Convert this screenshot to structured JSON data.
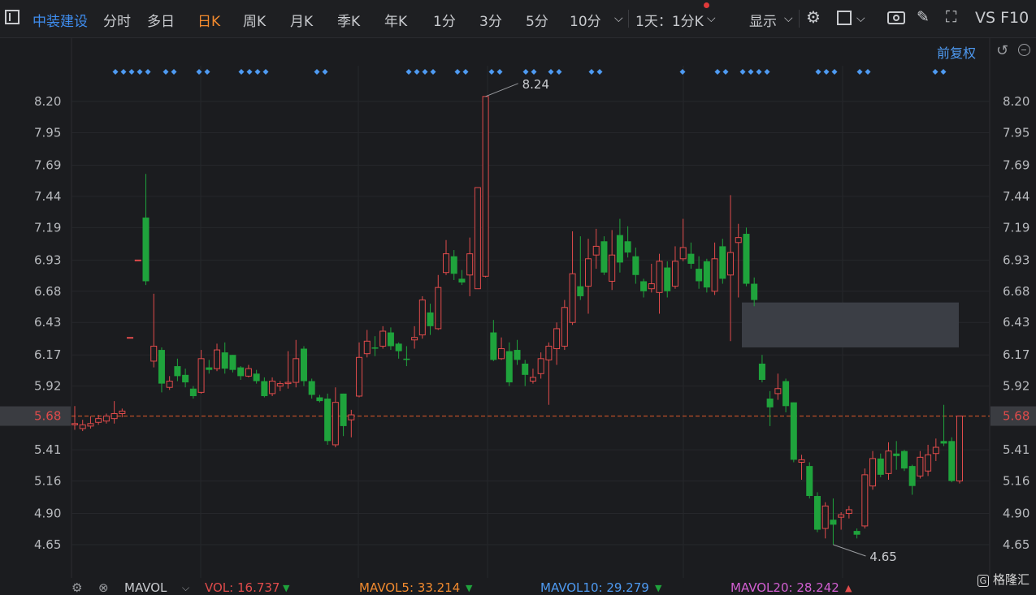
{
  "toolbar": {
    "stock_name": "中装建设",
    "periods": [
      "分时",
      "多日",
      "日K",
      "周K",
      "月K",
      "季K",
      "年K",
      "1分",
      "3分",
      "5分",
      "10分"
    ],
    "active_period": "日K",
    "range_select": "1天：1分K",
    "display_label": "显示",
    "right_text": "VS F10"
  },
  "sub_toolbar": {
    "adjust_label": "前复权"
  },
  "chart_data": {
    "type": "candlestick",
    "y_ticks": [
      8.2,
      7.95,
      7.69,
      7.44,
      7.19,
      6.93,
      6.68,
      6.43,
      6.17,
      5.92,
      5.68,
      5.41,
      5.16,
      4.9,
      4.65
    ],
    "y_tick_labels": [
      "8.20",
      "7.95",
      "7.69",
      "7.44",
      "7.19",
      "6.93",
      "6.68",
      "6.43",
      "6.17",
      "5.92",
      "5.68",
      "5.41",
      "5.16",
      "4.90",
      "4.65"
    ],
    "current_price": "5.68",
    "high_label": "8.24",
    "low_label": "4.65",
    "gap_zone": [
      6.23,
      6.59
    ],
    "up_color": "#e04b4b",
    "down_color": "#1fa33c",
    "candles": [
      {
        "o": 5.61,
        "c": 5.62,
        "h": 5.76,
        "l": 5.57
      },
      {
        "o": 5.58,
        "c": 5.61,
        "h": 5.65,
        "l": 5.56
      },
      {
        "o": 5.6,
        "c": 5.62,
        "h": 5.68,
        "l": 5.58
      },
      {
        "o": 5.63,
        "c": 5.66,
        "h": 5.69,
        "l": 5.61
      },
      {
        "o": 5.64,
        "c": 5.68,
        "h": 5.7,
        "l": 5.62
      },
      {
        "o": 5.66,
        "c": 5.7,
        "h": 5.8,
        "l": 5.62
      },
      {
        "o": 5.7,
        "c": 5.72,
        "h": 5.74,
        "l": 5.67
      },
      {
        "o": 6.31,
        "c": 6.31,
        "h": 6.31,
        "l": 6.31
      },
      {
        "o": 6.93,
        "c": 6.93,
        "h": 6.93,
        "l": 6.93
      },
      {
        "o": 7.27,
        "c": 6.76,
        "h": 7.62,
        "l": 6.73
      },
      {
        "o": 6.12,
        "c": 6.24,
        "h": 6.66,
        "l": 6.07
      },
      {
        "o": 6.21,
        "c": 5.94,
        "h": 6.23,
        "l": 5.87
      },
      {
        "o": 5.91,
        "c": 5.96,
        "h": 6.0,
        "l": 5.89
      },
      {
        "o": 6.08,
        "c": 6.0,
        "h": 6.14,
        "l": 5.96
      },
      {
        "o": 6.01,
        "c": 5.95,
        "h": 6.06,
        "l": 5.91
      },
      {
        "o": 5.9,
        "c": 5.84,
        "h": 5.92,
        "l": 5.82
      },
      {
        "o": 5.87,
        "c": 6.14,
        "h": 6.21,
        "l": 5.86
      },
      {
        "o": 6.07,
        "c": 6.05,
        "h": 6.13,
        "l": 6.02
      },
      {
        "o": 6.06,
        "c": 6.21,
        "h": 6.26,
        "l": 6.04
      },
      {
        "o": 6.19,
        "c": 6.06,
        "h": 6.27,
        "l": 6.02
      },
      {
        "o": 6.17,
        "c": 6.05,
        "h": 6.17,
        "l": 6.03
      },
      {
        "o": 6.07,
        "c": 6.0,
        "h": 6.08,
        "l": 5.97
      },
      {
        "o": 6.0,
        "c": 6.06,
        "h": 6.09,
        "l": 5.99
      },
      {
        "o": 6.02,
        "c": 5.96,
        "h": 6.05,
        "l": 5.94
      },
      {
        "o": 5.96,
        "c": 5.84,
        "h": 5.99,
        "l": 5.83
      },
      {
        "o": 5.86,
        "c": 5.96,
        "h": 5.99,
        "l": 5.84
      },
      {
        "o": 5.92,
        "c": 5.94,
        "h": 5.96,
        "l": 5.88
      },
      {
        "o": 5.94,
        "c": 5.95,
        "h": 6.2,
        "l": 5.9
      },
      {
        "o": 5.95,
        "c": 6.14,
        "h": 6.29,
        "l": 5.91
      },
      {
        "o": 6.22,
        "c": 5.96,
        "h": 6.24,
        "l": 5.92
      },
      {
        "o": 5.96,
        "c": 5.85,
        "h": 5.98,
        "l": 5.82
      },
      {
        "o": 5.83,
        "c": 5.8,
        "h": 5.85,
        "l": 5.79
      },
      {
        "o": 5.82,
        "c": 5.48,
        "h": 5.86,
        "l": 5.45
      },
      {
        "o": 5.45,
        "c": 5.79,
        "h": 5.91,
        "l": 5.43
      },
      {
        "o": 5.86,
        "c": 5.6,
        "h": 5.86,
        "l": 5.52
      },
      {
        "o": 5.65,
        "c": 5.69,
        "h": 5.73,
        "l": 5.51
      },
      {
        "o": 5.84,
        "c": 6.15,
        "h": 6.27,
        "l": 5.83
      },
      {
        "o": 6.18,
        "c": 6.28,
        "h": 6.37,
        "l": 6.15
      },
      {
        "o": 6.23,
        "c": 6.22,
        "h": 6.32,
        "l": 6.16
      },
      {
        "o": 6.24,
        "c": 6.36,
        "h": 6.4,
        "l": 6.22
      },
      {
        "o": 6.35,
        "c": 6.24,
        "h": 6.39,
        "l": 6.21
      },
      {
        "o": 6.26,
        "c": 6.2,
        "h": 6.27,
        "l": 6.14
      },
      {
        "o": 6.14,
        "c": 6.13,
        "h": 6.24,
        "l": 6.08
      },
      {
        "o": 6.29,
        "c": 6.31,
        "h": 6.4,
        "l": 6.22
      },
      {
        "o": 6.33,
        "c": 6.61,
        "h": 6.64,
        "l": 6.3
      },
      {
        "o": 6.51,
        "c": 6.4,
        "h": 6.58,
        "l": 6.33
      },
      {
        "o": 6.38,
        "c": 6.71,
        "h": 6.81,
        "l": 6.37
      },
      {
        "o": 6.83,
        "c": 6.98,
        "h": 7.09,
        "l": 6.81
      },
      {
        "o": 6.96,
        "c": 6.82,
        "h": 7.01,
        "l": 6.77
      },
      {
        "o": 6.78,
        "c": 6.75,
        "h": 6.85,
        "l": 6.73
      },
      {
        "o": 6.81,
        "c": 6.98,
        "h": 7.11,
        "l": 6.64
      },
      {
        "o": 6.7,
        "c": 7.51,
        "h": 7.51,
        "l": 6.7
      },
      {
        "o": 6.8,
        "c": 8.24,
        "h": 8.24,
        "l": 6.79
      },
      {
        "o": 6.35,
        "c": 6.13,
        "h": 6.45,
        "l": 6.12
      },
      {
        "o": 6.14,
        "c": 6.22,
        "h": 6.31,
        "l": 6.13
      },
      {
        "o": 6.2,
        "c": 5.95,
        "h": 6.27,
        "l": 5.92
      },
      {
        "o": 6.21,
        "c": 6.13,
        "h": 6.29,
        "l": 6.09
      },
      {
        "o": 6.1,
        "c": 6.01,
        "h": 6.13,
        "l": 5.92
      },
      {
        "o": 5.96,
        "c": 5.99,
        "h": 6.06,
        "l": 5.94
      },
      {
        "o": 6.02,
        "c": 6.14,
        "h": 6.19,
        "l": 5.98
      },
      {
        "o": 6.13,
        "c": 6.24,
        "h": 6.27,
        "l": 5.77
      },
      {
        "o": 6.22,
        "c": 6.38,
        "h": 6.43,
        "l": 6.09
      },
      {
        "o": 6.24,
        "c": 6.55,
        "h": 6.61,
        "l": 6.21
      },
      {
        "o": 6.43,
        "c": 6.82,
        "h": 7.16,
        "l": 6.41
      },
      {
        "o": 6.72,
        "c": 6.64,
        "h": 7.12,
        "l": 6.61
      },
      {
        "o": 6.72,
        "c": 6.94,
        "h": 7.1,
        "l": 6.5
      },
      {
        "o": 6.97,
        "c": 7.04,
        "h": 7.18,
        "l": 6.86
      },
      {
        "o": 7.08,
        "c": 6.83,
        "h": 7.12,
        "l": 6.81
      },
      {
        "o": 6.76,
        "c": 6.97,
        "h": 7.17,
        "l": 6.69
      },
      {
        "o": 7.13,
        "c": 6.91,
        "h": 7.26,
        "l": 6.83
      },
      {
        "o": 7.08,
        "c": 6.99,
        "h": 7.2,
        "l": 6.95
      },
      {
        "o": 6.96,
        "c": 6.81,
        "h": 7.03,
        "l": 6.74
      },
      {
        "o": 6.76,
        "c": 6.68,
        "h": 6.78,
        "l": 6.63
      },
      {
        "o": 6.7,
        "c": 6.74,
        "h": 6.9,
        "l": 6.67
      },
      {
        "o": 6.67,
        "c": 6.92,
        "h": 6.98,
        "l": 6.5
      },
      {
        "o": 6.87,
        "c": 6.68,
        "h": 6.92,
        "l": 6.63
      },
      {
        "o": 6.72,
        "c": 6.92,
        "h": 7.04,
        "l": 6.7
      },
      {
        "o": 6.94,
        "c": 7.03,
        "h": 7.26,
        "l": 6.92
      },
      {
        "o": 6.98,
        "c": 6.9,
        "h": 7.07,
        "l": 6.86
      },
      {
        "o": 6.86,
        "c": 6.76,
        "h": 6.96,
        "l": 6.7
      },
      {
        "o": 6.92,
        "c": 6.71,
        "h": 6.94,
        "l": 6.67
      },
      {
        "o": 6.68,
        "c": 6.94,
        "h": 7.07,
        "l": 6.65
      },
      {
        "o": 7.04,
        "c": 6.78,
        "h": 7.1,
        "l": 6.74
      },
      {
        "o": 6.81,
        "c": 6.99,
        "h": 7.45,
        "l": 6.28
      },
      {
        "o": 7.07,
        "c": 7.11,
        "h": 7.22,
        "l": 6.63
      },
      {
        "o": 7.14,
        "c": 6.74,
        "h": 7.19,
        "l": 6.72
      },
      {
        "o": 6.74,
        "c": 6.61,
        "h": 6.79,
        "l": 6.56
      },
      {
        "o": 6.1,
        "c": 5.97,
        "h": 6.17,
        "l": 5.95
      },
      {
        "o": 5.82,
        "c": 5.75,
        "h": 5.88,
        "l": 5.6
      },
      {
        "o": 5.86,
        "c": 5.9,
        "h": 6.02,
        "l": 5.81
      },
      {
        "o": 5.96,
        "c": 5.76,
        "h": 5.98,
        "l": 5.71
      },
      {
        "o": 5.79,
        "c": 5.33,
        "h": 5.79,
        "l": 5.31
      },
      {
        "o": 5.31,
        "c": 5.33,
        "h": 5.37,
        "l": 5.17
      },
      {
        "o": 5.28,
        "c": 5.04,
        "h": 5.31,
        "l": 5.02
      },
      {
        "o": 5.04,
        "c": 4.77,
        "h": 5.07,
        "l": 4.75
      },
      {
        "o": 4.78,
        "c": 4.96,
        "h": 4.99,
        "l": 4.7
      },
      {
        "o": 4.85,
        "c": 4.81,
        "h": 5.02,
        "l": 4.65
      },
      {
        "o": 4.87,
        "c": 4.89,
        "h": 4.91,
        "l": 4.77
      },
      {
        "o": 4.9,
        "c": 4.93,
        "h": 4.96,
        "l": 4.86
      },
      {
        "o": 4.76,
        "c": 4.73,
        "h": 4.78,
        "l": 4.7
      },
      {
        "o": 4.8,
        "c": 5.21,
        "h": 5.26,
        "l": 4.78
      },
      {
        "o": 5.12,
        "c": 5.34,
        "h": 5.4,
        "l": 5.09
      },
      {
        "o": 5.34,
        "c": 5.21,
        "h": 5.38,
        "l": 5.19
      },
      {
        "o": 5.22,
        "c": 5.4,
        "h": 5.47,
        "l": 5.17
      },
      {
        "o": 5.38,
        "c": 5.36,
        "h": 5.48,
        "l": 5.25
      },
      {
        "o": 5.4,
        "c": 5.26,
        "h": 5.41,
        "l": 5.24
      },
      {
        "o": 5.28,
        "c": 5.12,
        "h": 5.29,
        "l": 5.05
      },
      {
        "o": 5.2,
        "c": 5.35,
        "h": 5.4,
        "l": 5.18
      },
      {
        "o": 5.24,
        "c": 5.37,
        "h": 5.45,
        "l": 5.2
      },
      {
        "o": 5.38,
        "c": 5.43,
        "h": 5.5,
        "l": 5.32
      },
      {
        "o": 5.48,
        "c": 5.46,
        "h": 5.77,
        "l": 5.44
      },
      {
        "o": 5.48,
        "c": 5.16,
        "h": 5.51,
        "l": 5.15
      },
      {
        "o": 5.16,
        "c": 5.68,
        "h": 5.68,
        "l": 5.14
      }
    ]
  },
  "bottom_bar": {
    "ma_label": "MAVOL",
    "vol": "VOL: 16.737",
    "mavol5": "MAVOL5: 33.214",
    "mavol10": "MAVOL10: 29.279",
    "mavol20": "MAVOL20: 28.242"
  },
  "watermark": "格隆汇"
}
